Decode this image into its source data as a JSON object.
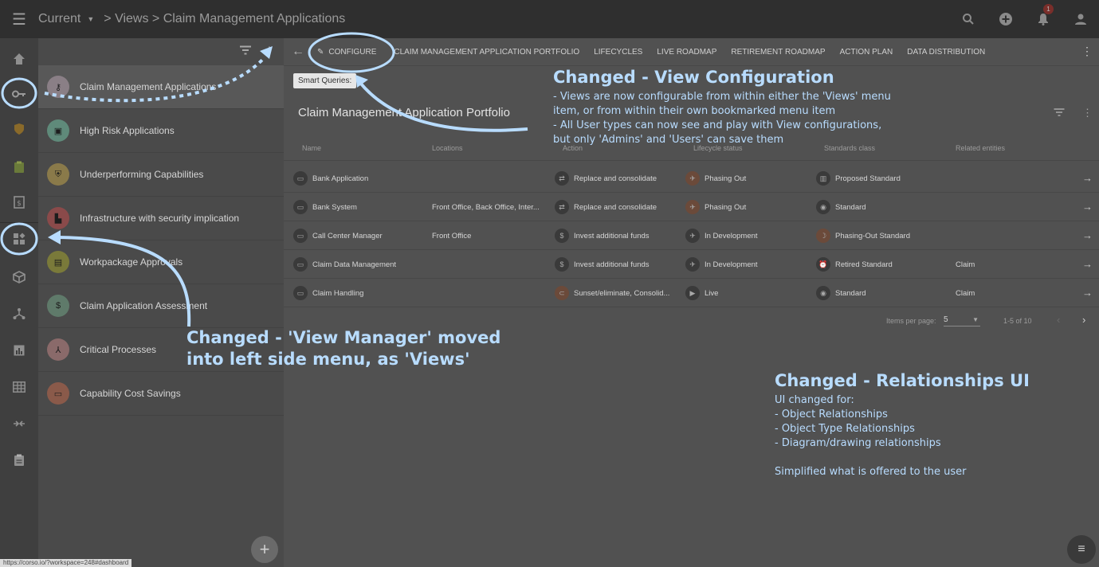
{
  "topbar": {
    "current_label": "Current",
    "breadcrumb": "> Views > Claim Management Applications",
    "notification_count": "1"
  },
  "views_panel": {
    "items": [
      {
        "label": "Claim Management Applications",
        "icon": "key-icon",
        "color": "#8a7f86"
      },
      {
        "label": "High Risk Applications",
        "icon": "window-icon",
        "color": "#5f8a7a"
      },
      {
        "label": "Underperforming Capabilities",
        "icon": "shield-icon",
        "color": "#8a7a4a"
      },
      {
        "label": "Infrastructure with security implication",
        "icon": "factory-icon",
        "color": "#8a4a4a"
      },
      {
        "label": "Workpackage Approvals",
        "icon": "clipboard-icon",
        "color": "#7a7a3a"
      },
      {
        "label": "Claim Application Assessment",
        "icon": "dollar-icon",
        "color": "#5f7a6a"
      },
      {
        "label": "Critical Processes",
        "icon": "network-icon",
        "color": "#8a6a6a"
      },
      {
        "label": "Capability Cost Savings",
        "icon": "money-icon",
        "color": "#8a5a4a"
      }
    ],
    "add_label": "+"
  },
  "tabs": [
    {
      "label": "CONFIGURE",
      "icon": "pencil-icon"
    },
    {
      "label": "CLAIM MANAGEMENT APPLICATION PORTFOLIO"
    },
    {
      "label": "LIFECYCLES"
    },
    {
      "label": "LIVE ROADMAP"
    },
    {
      "label": "RETIREMENT ROADMAP"
    },
    {
      "label": "ACTION PLAN"
    },
    {
      "label": "DATA DISTRIBUTION"
    }
  ],
  "smart_queries_label": "Smart Queries:",
  "portfolio_title": "Claim Management Application Portfolio",
  "table": {
    "headers": [
      "Name",
      "Locations",
      "Action",
      "Lifecycle status",
      "Standards class",
      "Related entities"
    ],
    "rows": [
      {
        "name": "Bank Application",
        "location": "",
        "action": "Replace and consolidate",
        "lifecycle": "Phasing Out",
        "standard": "Proposed Standard",
        "related": ""
      },
      {
        "name": "Bank System",
        "location": "Front Office, Back Office, Inter...",
        "action": "Replace and consolidate",
        "lifecycle": "Phasing Out",
        "standard": "Standard",
        "related": ""
      },
      {
        "name": "Call Center Manager",
        "location": "Front Office",
        "action": "Invest additional funds",
        "lifecycle": "In Development",
        "standard": "Phasing-Out Standard",
        "related": ""
      },
      {
        "name": "Claim Data Management",
        "location": "",
        "action": "Invest additional funds",
        "lifecycle": "In Development",
        "standard": "Retired Standard",
        "related": "Claim"
      },
      {
        "name": "Claim Handling",
        "location": "",
        "action": "Sunset/eliminate, Consolid...",
        "lifecycle": "Live",
        "standard": "Standard",
        "related": "Claim"
      }
    ],
    "items_per_page_label": "Items per page:",
    "items_per_page": "5",
    "range": "1-5 of 10"
  },
  "status_url": "https://corso.io/?workspace=248#dashboard",
  "annotations": {
    "view_config_title": "Changed - View Configuration",
    "view_config_lines": [
      "- Views are now configurable from within either the 'Views' menu",
      "item, or from within their own bookmarked menu item",
      "- All User types can now see and play with View configurations,",
      "but only 'Admins' and 'Users' can save them"
    ],
    "view_manager_lines": [
      "Changed - 'View Manager' moved",
      "into left side menu, as 'Views'"
    ],
    "relationships_title": "Changed - Relationships UI",
    "relationships_lines": [
      "UI changed for:",
      "- Object Relationships",
      "- Object Type Relationships",
      "- Diagram/drawing relationships",
      "",
      "Simplified what is offered to the user"
    ]
  },
  "colors": {
    "annotation": "#b8dcff",
    "topbar": "#2f2f2f"
  }
}
